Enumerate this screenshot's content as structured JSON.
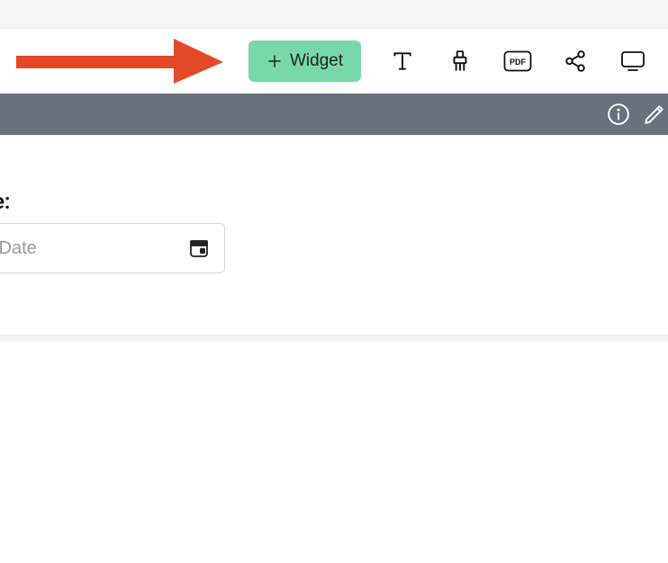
{
  "toolbar": {
    "widget_button_label": "Widget"
  },
  "subbar": {},
  "form": {
    "date_label_fragment": "e:",
    "date_placeholder_fragment": " Date"
  },
  "colors": {
    "arrow": "#e24a27",
    "widget_button_bg": "#79d8a8",
    "subbar_bg": "#68717d"
  }
}
